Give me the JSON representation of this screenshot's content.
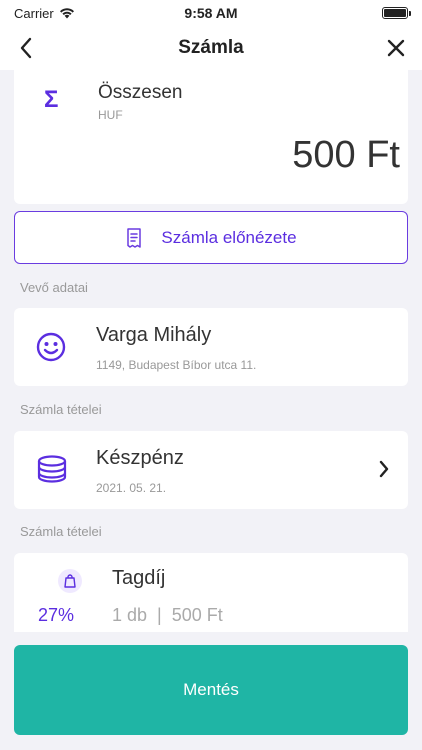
{
  "status_bar": {
    "carrier": "Carrier",
    "time": "9:58 AM"
  },
  "nav": {
    "title": "Számla"
  },
  "total": {
    "label": "Összesen",
    "currency": "HUF",
    "amount": "500 Ft"
  },
  "preview": {
    "label": "Számla előnézete"
  },
  "buyer_section": {
    "label": "Vevő adatai"
  },
  "buyer": {
    "name": "Varga Mihály",
    "address": "1149, Budapest Bíbor utca 11."
  },
  "payment_section": {
    "label": "Számla tételei"
  },
  "payment": {
    "method": "Készpénz",
    "date": "2021. 05. 21."
  },
  "items_section": {
    "label": "Számla tételei"
  },
  "item": {
    "name": "Tagdíj",
    "percent": "27%",
    "quantity": "1 db",
    "separator": "|",
    "price": "500 Ft"
  },
  "save": {
    "label": "Mentés"
  },
  "colors": {
    "accent": "#5b2ee0",
    "save": "#1fb5a5",
    "background": "#f2f2f7"
  }
}
